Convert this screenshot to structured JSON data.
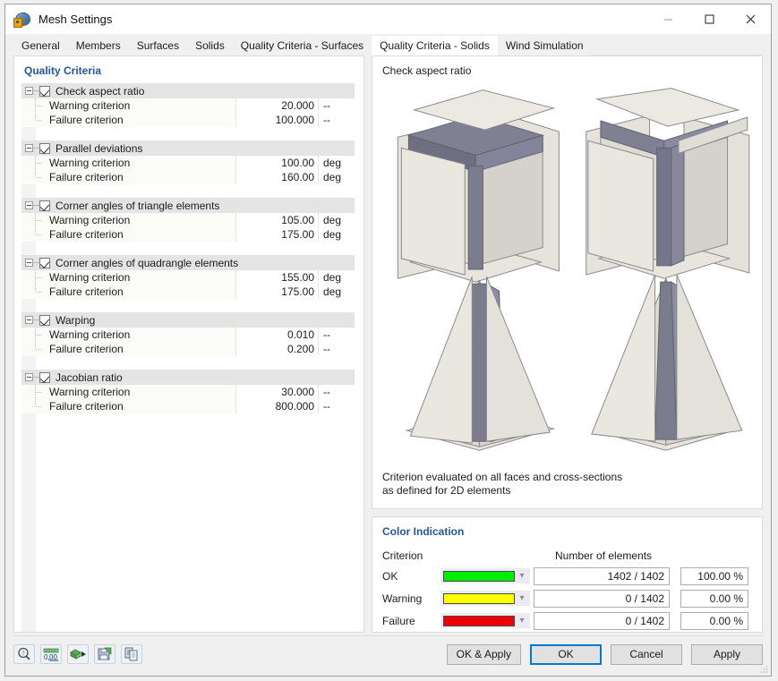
{
  "window": {
    "title": "Mesh Settings",
    "icon": "mesh-settings-icon",
    "minimize": "minimize-icon",
    "maximize": "maximize-icon",
    "close": "close-icon"
  },
  "tabs": [
    {
      "label": "General",
      "active": false
    },
    {
      "label": "Members",
      "active": false
    },
    {
      "label": "Surfaces",
      "active": false
    },
    {
      "label": "Solids",
      "active": false
    },
    {
      "label": "Quality Criteria - Surfaces",
      "active": false
    },
    {
      "label": "Quality Criteria - Solids",
      "active": true
    },
    {
      "label": "Wind Simulation",
      "active": false
    }
  ],
  "left_pane": {
    "title": "Quality Criteria",
    "groups": [
      {
        "label": "Check aspect ratio",
        "checked": true,
        "rows": [
          {
            "label": "Warning criterion",
            "value": "20.000",
            "unit": "--"
          },
          {
            "label": "Failure criterion",
            "value": "100.000",
            "unit": "--"
          }
        ]
      },
      {
        "label": "Parallel deviations",
        "checked": true,
        "rows": [
          {
            "label": "Warning criterion",
            "value": "100.00",
            "unit": "deg"
          },
          {
            "label": "Failure criterion",
            "value": "160.00",
            "unit": "deg"
          }
        ]
      },
      {
        "label": "Corner angles of triangle elements",
        "checked": true,
        "rows": [
          {
            "label": "Warning criterion",
            "value": "105.00",
            "unit": "deg"
          },
          {
            "label": "Failure criterion",
            "value": "175.00",
            "unit": "deg"
          }
        ]
      },
      {
        "label": "Corner angles of quadrangle elements",
        "checked": true,
        "rows": [
          {
            "label": "Warning criterion",
            "value": "155.00",
            "unit": "deg"
          },
          {
            "label": "Failure criterion",
            "value": "175.00",
            "unit": "deg"
          }
        ]
      },
      {
        "label": "Warping",
        "checked": true,
        "rows": [
          {
            "label": "Warning criterion",
            "value": "0.010",
            "unit": "--"
          },
          {
            "label": "Failure criterion",
            "value": "0.200",
            "unit": "--"
          }
        ]
      },
      {
        "label": "Jacobian ratio",
        "checked": true,
        "rows": [
          {
            "label": "Warning criterion",
            "value": "30.000",
            "unit": "--"
          },
          {
            "label": "Failure criterion",
            "value": "800.000",
            "unit": "--"
          }
        ]
      }
    ]
  },
  "preview": {
    "title": "Check aspect ratio",
    "note": "Criterion evaluated on all faces and cross-sections\nas defined for 2D elements"
  },
  "color_indication": {
    "title": "Color Indication",
    "header_criterion": "Criterion",
    "header_count": "Number of elements",
    "rows": [
      {
        "criterion": "OK",
        "color": "#00EE00",
        "count": "1402 / 1402",
        "percent": "100.00 %"
      },
      {
        "criterion": "Warning",
        "color": "#FFFF00",
        "count": "0 / 1402",
        "percent": "0.00 %"
      },
      {
        "criterion": "Failure",
        "color": "#EE0000",
        "count": "0 / 1402",
        "percent": "0.00 %"
      }
    ]
  },
  "footer": {
    "tools": [
      {
        "name": "help-search-icon"
      },
      {
        "name": "number-format-icon"
      },
      {
        "name": "run-mesh-icon"
      },
      {
        "name": "save-settings-icon"
      },
      {
        "name": "copy-settings-icon"
      }
    ],
    "buttons": [
      {
        "label": "OK & Apply",
        "default": false
      },
      {
        "label": "OK",
        "default": true
      },
      {
        "label": "Cancel",
        "default": false
      },
      {
        "label": "Apply",
        "default": false
      }
    ]
  }
}
